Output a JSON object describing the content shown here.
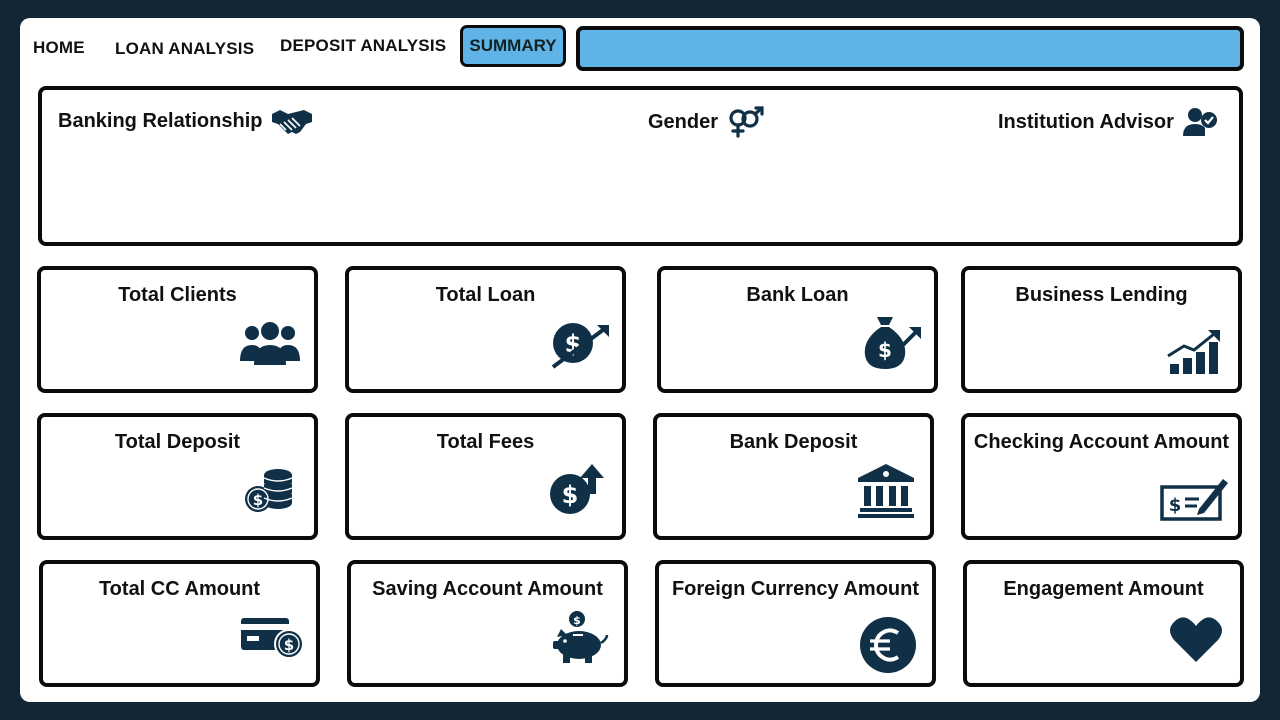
{
  "nav": {
    "home": "HOME",
    "loan_analysis": "LOAN ANALYSIS",
    "deposit_analysis": "DEPOSIT ANALYSIS",
    "summary": "SUMMARY"
  },
  "filters": {
    "banking_relationship": "Banking Relationship",
    "gender": "Gender",
    "institution_advisor": "Institution Advisor"
  },
  "cards": {
    "total_clients": "Total Clients",
    "total_loan": "Total Loan",
    "bank_loan": "Bank Loan",
    "business_lending": "Business Lending",
    "total_deposit": "Total Deposit",
    "total_fees": "Total Fees",
    "bank_deposit": "Bank Deposit",
    "checking_account_amount": "Checking Account Amount",
    "total_cc_amount": "Total CC Amount",
    "saving_account_amount": "Saving Account Amount",
    "foreign_currency_amount": "Foreign Currency Amount",
    "engagement_amount": "Engagement Amount"
  },
  "colors": {
    "background": "#132635",
    "accent": "#5fb3e6",
    "icon": "#0f3047"
  }
}
